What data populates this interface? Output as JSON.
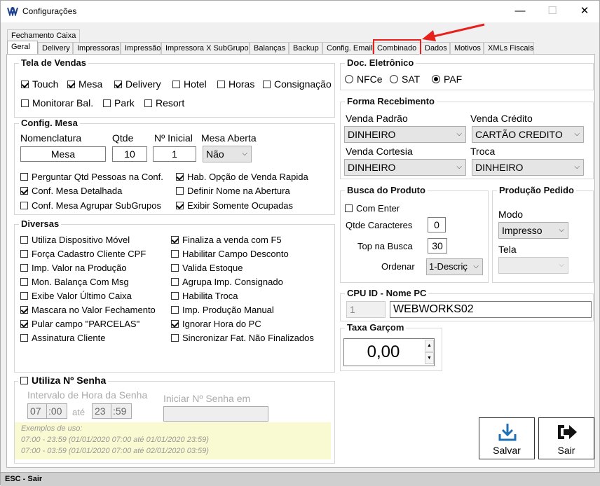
{
  "window": {
    "title": "Configurações",
    "minimize": "—",
    "maximize": "☐",
    "close": "✕"
  },
  "tabs_top": [
    "Fechamento Caixa"
  ],
  "tabs": [
    "Geral",
    "Delivery",
    "Impressoras",
    "Impressão",
    "Impressora X SubGrupo",
    "Balanças",
    "Backup",
    "Config. Email",
    "Combinado",
    "Dados",
    "Motivos",
    "XMLs Fiscais"
  ],
  "tela_vendas": {
    "title": "Tela de Vendas",
    "items": [
      {
        "label": "Touch",
        "checked": true
      },
      {
        "label": "Mesa",
        "checked": true
      },
      {
        "label": "Delivery",
        "checked": true
      },
      {
        "label": "Hotel",
        "checked": false
      },
      {
        "label": "Horas",
        "checked": false
      },
      {
        "label": "Consignação",
        "checked": false
      },
      {
        "label": "Monitorar Bal.",
        "checked": false
      },
      {
        "label": "Park",
        "checked": false
      },
      {
        "label": "Resort",
        "checked": false
      }
    ]
  },
  "config_mesa": {
    "title": "Config. Mesa",
    "nomenclatura_label": "Nomenclatura",
    "nomenclatura": "Mesa",
    "qtde_label": "Qtde",
    "qtde": "10",
    "inicial_label": "Nº Inicial",
    "inicial": "1",
    "aberta_label": "Mesa Aberta",
    "aberta": "Não",
    "items": [
      {
        "label": "Perguntar Qtd Pessoas na Conf.",
        "checked": false
      },
      {
        "label": "Hab. Opção de Venda Rapida",
        "checked": true
      },
      {
        "label": "Conf. Mesa Detalhada",
        "checked": true
      },
      {
        "label": "Definir Nome na Abertura",
        "checked": false
      },
      {
        "label": "Conf. Mesa Agrupar SubGrupos",
        "checked": false
      },
      {
        "label": "Exibir Somente Ocupadas",
        "checked": true
      }
    ]
  },
  "diversas": {
    "title": "Diversas",
    "left": [
      {
        "label": "Utiliza Dispositivo Móvel",
        "checked": false
      },
      {
        "label": "Força Cadastro Cliente CPF",
        "checked": false
      },
      {
        "label": "Imp. Valor na Produção",
        "checked": false
      },
      {
        "label": "Mon. Balança Com Msg",
        "checked": false
      },
      {
        "label": "Exibe Valor Último Caixa",
        "checked": false
      },
      {
        "label": "Mascara no Valor Fechamento",
        "checked": true
      },
      {
        "label": "Pular campo \"PARCELAS\"",
        "checked": true
      },
      {
        "label": "Assinatura Cliente",
        "checked": false
      }
    ],
    "right": [
      {
        "label": "Finaliza a venda com F5",
        "checked": true
      },
      {
        "label": "Habilitar Campo Desconto",
        "checked": false
      },
      {
        "label": "Valida Estoque",
        "checked": false
      },
      {
        "label": "Agrupa Imp. Consignado",
        "checked": false
      },
      {
        "label": "Habilita Troca",
        "checked": false
      },
      {
        "label": "Imp. Produção Manual",
        "checked": false
      },
      {
        "label": "Ignorar Hora do PC",
        "checked": true
      },
      {
        "label": "Sincronizar Fat. Não Finalizados",
        "checked": false
      }
    ]
  },
  "senha": {
    "title": "Utiliza Nº Senha",
    "checked": false,
    "intervalo_label": "Intervalo de Hora da Senha",
    "h1": "07",
    "m1": ":00",
    "ate": "até",
    "h2": "23",
    "m2": ":59",
    "iniciar_label": "Iniciar Nº Senha em",
    "iniciar": "",
    "exemplos_title": "Exemplos de uso:",
    "exemplo1": "07:00 - 23:59 (01/01/2020 07:00 até 01/01/2020 23:59)",
    "exemplo2": "07:00 - 03:59 (01/01/2020 07:00 até 02/01/2020 03:59)"
  },
  "doc_eletronico": {
    "title": "Doc. Eletrônico",
    "options": [
      {
        "label": "NFCe",
        "selected": false
      },
      {
        "label": "SAT",
        "selected": false
      },
      {
        "label": "PAF",
        "selected": true
      }
    ]
  },
  "forma_recebimento": {
    "title": "Forma Recebimento",
    "venda_padrao_label": "Venda Padrão",
    "venda_padrao": "DINHEIRO",
    "venda_credito_label": "Venda Crédito",
    "venda_credito": "CARTÃO CREDITO",
    "venda_cortesia_label": "Venda Cortesia",
    "venda_cortesia": "DINHEIRO",
    "troca_label": "Troca",
    "troca": "DINHEIRO"
  },
  "busca_produto": {
    "title": "Busca do Produto",
    "com_enter": "Com Enter",
    "com_enter_checked": false,
    "qtde_label": "Qtde Caracteres",
    "qtde": "0",
    "top_label": "Top na Busca",
    "top": "30",
    "ordenar_label": "Ordenar",
    "ordenar": "1-Descriç"
  },
  "producao_pedido": {
    "title": "Produção Pedido",
    "modo_label": "Modo",
    "modo": "Impresso",
    "tela_label": "Tela",
    "tela": ""
  },
  "cpu": {
    "title": "CPU ID - Nome PC",
    "id": "1",
    "nome": "WEBWORKS02"
  },
  "taxa": {
    "title": "Taxa Garçom",
    "value": "0,00"
  },
  "buttons": {
    "salvar": "Salvar",
    "sair": "Sair"
  },
  "status": "ESC - Sair",
  "colors": {
    "highlight": "#e8201c",
    "arrow": "#e8201c",
    "save_icon": "#1f6fb5",
    "hint_bg": "#fafad2"
  }
}
